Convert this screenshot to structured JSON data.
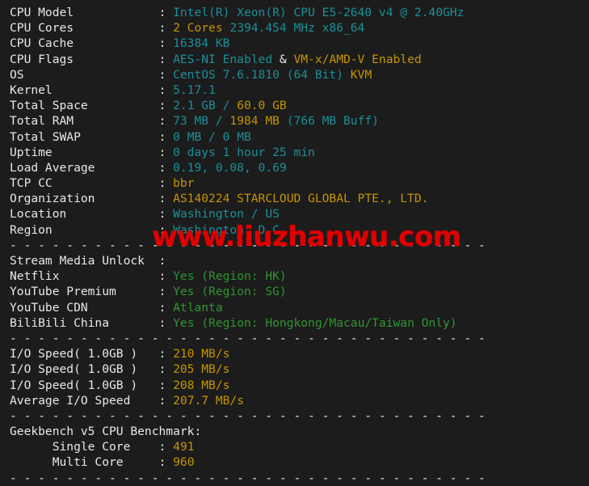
{
  "terminal": {
    "background_color": "#1c1c1c",
    "colors": {
      "label": "#e8e8e8",
      "cyan": "#1b8f99",
      "yellow": "#c59400",
      "green": "#2f9630",
      "separator": "#e8e8e8",
      "watermark": "#e00000"
    },
    "separator": "---------------------------------------------------------------",
    "lines": [
      {
        "id": "cpu-model",
        "label": "CPU Model",
        "colon": ":",
        "parts": [
          {
            "text": "Intel(R) Xeon(R) CPU E5-2640 v4 @ 2.40GHz",
            "color": "cyan"
          }
        ]
      },
      {
        "id": "cpu-cores",
        "label": "CPU Cores",
        "colon": ":",
        "parts": [
          {
            "text": "2 Cores",
            "color": "yellow"
          },
          {
            "text": " 2394.454 MHz x86_64",
            "color": "cyan"
          }
        ]
      },
      {
        "id": "cpu-cache",
        "label": "CPU Cache",
        "colon": ":",
        "parts": [
          {
            "text": "16384 KB",
            "color": "cyan"
          }
        ]
      },
      {
        "id": "cpu-flags",
        "label": "CPU Flags",
        "colon": ":",
        "parts": [
          {
            "text": "AES-NI Enabled",
            "color": "cyan"
          },
          {
            "text": " & ",
            "color": "white"
          },
          {
            "text": "VM-x/AMD-V Enabled",
            "color": "yellow"
          }
        ]
      },
      {
        "id": "os",
        "label": "OS",
        "colon": ":",
        "parts": [
          {
            "text": "CentOS 7.6.1810 (64 Bit) ",
            "color": "cyan"
          },
          {
            "text": "KVM",
            "color": "yellow"
          }
        ]
      },
      {
        "id": "kernel",
        "label": "Kernel",
        "colon": ":",
        "parts": [
          {
            "text": "5.17.1",
            "color": "cyan"
          }
        ]
      },
      {
        "id": "total-space",
        "label": "Total Space",
        "colon": ":",
        "parts": [
          {
            "text": "2.1 GB / ",
            "color": "cyan"
          },
          {
            "text": "60.0 GB",
            "color": "yellow"
          }
        ]
      },
      {
        "id": "total-ram",
        "label": "Total RAM",
        "colon": ":",
        "parts": [
          {
            "text": "73 MB / ",
            "color": "cyan"
          },
          {
            "text": "1984 MB",
            "color": "yellow"
          },
          {
            "text": " (766 MB Buff)",
            "color": "cyan"
          }
        ]
      },
      {
        "id": "total-swap",
        "label": "Total SWAP",
        "colon": ":",
        "parts": [
          {
            "text": "0 MB / 0 MB",
            "color": "cyan"
          }
        ]
      },
      {
        "id": "uptime",
        "label": "Uptime",
        "colon": ":",
        "parts": [
          {
            "text": "0 days 1 hour 25 min",
            "color": "cyan"
          }
        ]
      },
      {
        "id": "load-average",
        "label": "Load Average",
        "colon": ":",
        "parts": [
          {
            "text": "0.19, 0.08, 0.69",
            "color": "cyan"
          }
        ]
      },
      {
        "id": "tcp-cc",
        "label": "TCP CC",
        "colon": ":",
        "parts": [
          {
            "text": "bbr",
            "color": "yellow"
          }
        ]
      },
      {
        "id": "organization",
        "label": "Organization",
        "colon": ":",
        "parts": [
          {
            "text": "AS140224 STARCLOUD GLOBAL PTE., LTD.",
            "color": "yellow"
          }
        ]
      },
      {
        "id": "location",
        "label": "Location",
        "colon": ":",
        "parts": [
          {
            "text": "Washington / US",
            "color": "cyan"
          }
        ]
      },
      {
        "id": "region",
        "label": "Region",
        "colon": ":",
        "parts": [
          {
            "text": "Washington, D.C",
            "color": "cyan"
          }
        ]
      },
      {
        "id": "separator-1",
        "type": "separator"
      },
      {
        "id": "stream-media-unlock",
        "label": "Stream Media Unlock",
        "colon": ":",
        "parts": []
      },
      {
        "id": "netflix",
        "label": "Netflix",
        "colon": ":",
        "parts": [
          {
            "text": "Yes (Region: HK)",
            "color": "green"
          }
        ]
      },
      {
        "id": "youtube-premium",
        "label": "YouTube Premium",
        "colon": ":",
        "parts": [
          {
            "text": "Yes (Region: SG)",
            "color": "green"
          }
        ]
      },
      {
        "id": "youtube-cdn",
        "label": "YouTube CDN",
        "colon": ":",
        "parts": [
          {
            "text": "Atlanta",
            "color": "green"
          }
        ]
      },
      {
        "id": "bilibili-china",
        "label": "BiliBili China",
        "colon": ":",
        "parts": [
          {
            "text": "Yes (Region: Hongkong/Macau/Taiwan Only)",
            "color": "green"
          }
        ]
      },
      {
        "id": "separator-2",
        "type": "separator"
      },
      {
        "id": "io-speed-1",
        "label": "I/O Speed( 1.0GB )",
        "colon": ":",
        "parts": [
          {
            "text": "210 MB/s",
            "color": "yellow"
          }
        ]
      },
      {
        "id": "io-speed-2",
        "label": "I/O Speed( 1.0GB )",
        "colon": ":",
        "parts": [
          {
            "text": "205 MB/s",
            "color": "yellow"
          }
        ]
      },
      {
        "id": "io-speed-3",
        "label": "I/O Speed( 1.0GB )",
        "colon": ":",
        "parts": [
          {
            "text": "208 MB/s",
            "color": "yellow"
          }
        ]
      },
      {
        "id": "average-io-speed",
        "label": "Average I/O Speed",
        "colon": ":",
        "parts": [
          {
            "text": "207.7 MB/s",
            "color": "yellow"
          }
        ]
      },
      {
        "id": "separator-3",
        "type": "separator"
      },
      {
        "id": "geekbench-heading",
        "label": "Geekbench v5 CPU Benchmark:",
        "colon": "",
        "parts": []
      },
      {
        "id": "single-core",
        "label": "      Single Core",
        "colon": ":",
        "parts": [
          {
            "text": "491",
            "color": "yellow"
          }
        ]
      },
      {
        "id": "multi-core",
        "label": "      Multi Core",
        "colon": ":",
        "parts": [
          {
            "text": "960",
            "color": "yellow"
          }
        ]
      },
      {
        "id": "separator-4",
        "type": "separator"
      }
    ]
  },
  "watermark": {
    "text": "www.liuzhanwu.com"
  }
}
